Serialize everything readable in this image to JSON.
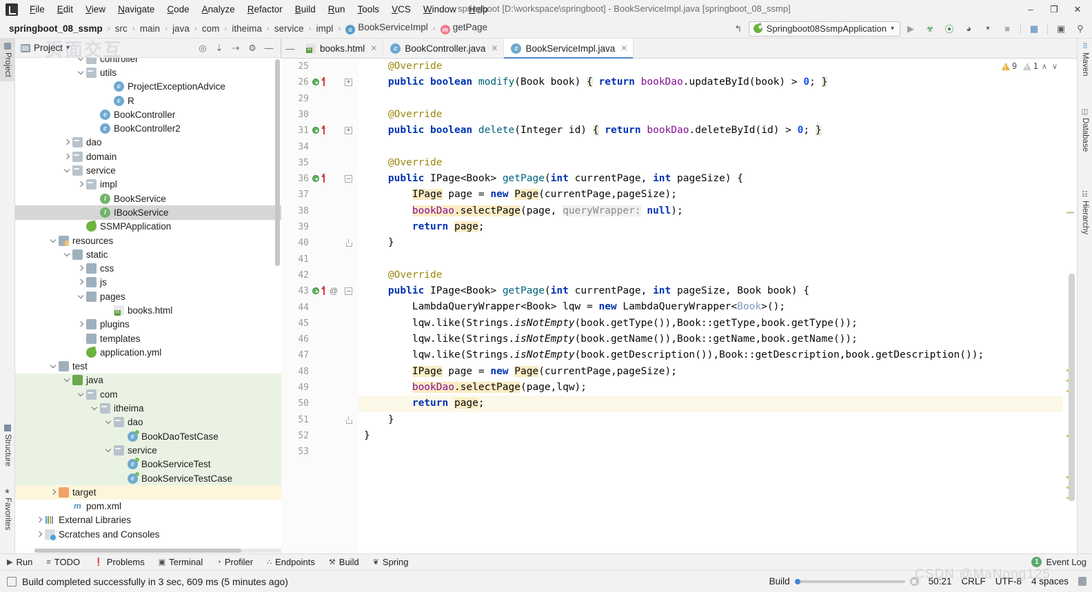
{
  "window": {
    "title": "springboot [D:\\workspace\\springboot] - BookServiceImpl.java [springboot_08_ssmp]",
    "minimize": "–",
    "maximize": "❐",
    "close": "✕"
  },
  "menubar": {
    "items": [
      "File",
      "Edit",
      "View",
      "Navigate",
      "Code",
      "Analyze",
      "Refactor",
      "Build",
      "Run",
      "Tools",
      "VCS",
      "Window",
      "Help"
    ]
  },
  "navbar": {
    "crumbs": [
      {
        "label": "springboot_08_ssmp",
        "bold": true,
        "icon": ""
      },
      {
        "label": "src",
        "bold": false,
        "icon": ""
      },
      {
        "label": "main",
        "bold": false,
        "icon": ""
      },
      {
        "label": "java",
        "bold": false,
        "icon": ""
      },
      {
        "label": "com",
        "bold": false,
        "icon": ""
      },
      {
        "label": "itheima",
        "bold": false,
        "icon": ""
      },
      {
        "label": "service",
        "bold": false,
        "icon": ""
      },
      {
        "label": "impl",
        "bold": false,
        "icon": ""
      },
      {
        "label": "BookServiceImpl",
        "bold": false,
        "icon": "c"
      },
      {
        "label": "getPage",
        "bold": false,
        "icon": "m"
      }
    ],
    "separator": "›",
    "run_config": "Springboot08SsmpApplication",
    "run_config_caret": "▾",
    "back_arrow_icon": "back-arrow-icon",
    "buttons": [
      {
        "name": "run-button",
        "glyph": "▶"
      },
      {
        "name": "debug-button",
        "glyph": "☢"
      },
      {
        "name": "run-with-coverage-button",
        "glyph": "⧉"
      },
      {
        "name": "profile-button",
        "glyph": "◔"
      },
      {
        "name": "profile-dropdown",
        "glyph": "▾"
      },
      {
        "name": "stop-button",
        "glyph": "■"
      },
      {
        "name": "project-structure-button",
        "glyph": "▤"
      },
      {
        "name": "search-everywhere-button",
        "glyph": "⌕"
      }
    ]
  },
  "left_strip": {
    "project_label": "Project",
    "structure_label": "Structure",
    "favorites_label": "Favorites"
  },
  "right_strip": {
    "maven_label": "Maven",
    "database_label": "Database",
    "hierarchy_label": "Hierarchy"
  },
  "project_panel": {
    "title": "Project",
    "title_caret": "▾",
    "watermark": "页面交互",
    "tools": [
      {
        "name": "locate-file-icon",
        "glyph": "⌖"
      },
      {
        "name": "expand-all-icon",
        "glyph": "⤓"
      },
      {
        "name": "collapse-all-icon",
        "glyph": "⤒"
      },
      {
        "name": "settings-gear-icon",
        "glyph": "⚙"
      },
      {
        "name": "hide-panel-icon",
        "glyph": "—"
      }
    ],
    "tree": [
      {
        "label": "controller",
        "indent": 4,
        "arrow": "d",
        "icon": "f-pkg",
        "state": "clipped"
      },
      {
        "label": "utils",
        "indent": 4,
        "arrow": "d",
        "icon": "f-pkg",
        "state": ""
      },
      {
        "label": "ProjectExceptionAdvice",
        "indent": 6,
        "arrow": "",
        "icon": "cls",
        "state": ""
      },
      {
        "label": "R",
        "indent": 6,
        "arrow": "",
        "icon": "cls",
        "state": ""
      },
      {
        "label": "BookController",
        "indent": 5,
        "arrow": "",
        "icon": "cls",
        "state": ""
      },
      {
        "label": "BookController2",
        "indent": 5,
        "arrow": "",
        "icon": "cls",
        "state": ""
      },
      {
        "label": "dao",
        "indent": 3,
        "arrow": "r",
        "icon": "f-pkg",
        "state": ""
      },
      {
        "label": "domain",
        "indent": 3,
        "arrow": "r",
        "icon": "f-pkg",
        "state": ""
      },
      {
        "label": "service",
        "indent": 3,
        "arrow": "d",
        "icon": "f-pkg",
        "state": ""
      },
      {
        "label": "impl",
        "indent": 4,
        "arrow": "r",
        "icon": "f-pkg",
        "state": ""
      },
      {
        "label": "BookService",
        "indent": 5,
        "arrow": "",
        "icon": "iface",
        "state": ""
      },
      {
        "label": "IBookService",
        "indent": 5,
        "arrow": "",
        "icon": "iface",
        "state": "sel"
      },
      {
        "label": "SSMPApplication",
        "indent": 4,
        "arrow": "",
        "icon": "spr",
        "state": ""
      },
      {
        "label": "resources",
        "indent": 2,
        "arrow": "d",
        "icon": "f-res",
        "state": ""
      },
      {
        "label": "static",
        "indent": 3,
        "arrow": "d",
        "icon": "f-plain",
        "state": ""
      },
      {
        "label": "css",
        "indent": 4,
        "arrow": "r",
        "icon": "f-plain",
        "state": ""
      },
      {
        "label": "js",
        "indent": 4,
        "arrow": "r",
        "icon": "f-plain",
        "state": ""
      },
      {
        "label": "pages",
        "indent": 4,
        "arrow": "d",
        "icon": "f-plain",
        "state": ""
      },
      {
        "label": "books.html",
        "indent": 6,
        "arrow": "",
        "icon": "html-ico",
        "state": ""
      },
      {
        "label": "plugins",
        "indent": 4,
        "arrow": "r",
        "icon": "f-plain",
        "state": ""
      },
      {
        "label": "templates",
        "indent": 4,
        "arrow": "",
        "icon": "f-plain",
        "state": ""
      },
      {
        "label": "application.yml",
        "indent": 4,
        "arrow": "",
        "icon": "spr",
        "state": ""
      },
      {
        "label": "test",
        "indent": 2,
        "arrow": "d",
        "icon": "f-plain",
        "state": ""
      },
      {
        "label": "java",
        "indent": 3,
        "arrow": "d",
        "icon": "f-src",
        "state": "green"
      },
      {
        "label": "com",
        "indent": 4,
        "arrow": "d",
        "icon": "f-pkg",
        "state": "green"
      },
      {
        "label": "itheima",
        "indent": 5,
        "arrow": "d",
        "icon": "f-pkg",
        "state": "green"
      },
      {
        "label": "dao",
        "indent": 6,
        "arrow": "d",
        "icon": "f-pkg",
        "state": "green"
      },
      {
        "label": "BookDaoTestCase",
        "indent": 7,
        "arrow": "",
        "icon": "cls test",
        "state": "green"
      },
      {
        "label": "service",
        "indent": 6,
        "arrow": "d",
        "icon": "f-pkg",
        "state": "green"
      },
      {
        "label": "BookServiceTest",
        "indent": 7,
        "arrow": "",
        "icon": "cls test",
        "state": "green"
      },
      {
        "label": "BookServiceTestCase",
        "indent": 7,
        "arrow": "",
        "icon": "cls test",
        "state": "green"
      },
      {
        "label": "target",
        "indent": 2,
        "arrow": "r",
        "icon": "f-tgt",
        "state": "amber"
      },
      {
        "label": "pom.xml",
        "indent": 3,
        "arrow": "",
        "icon": "mvn",
        "state": ""
      },
      {
        "label": "External Libraries",
        "indent": 1,
        "arrow": "r",
        "icon": "lib-ico",
        "state": ""
      },
      {
        "label": "Scratches and Consoles",
        "indent": 1,
        "arrow": "r",
        "icon": "scr-ico",
        "state": ""
      }
    ]
  },
  "editor": {
    "tabs": [
      {
        "label": "books.html",
        "icon": "html-file-icon",
        "active": false
      },
      {
        "label": "BookController.java",
        "icon": "java-class-icon",
        "active": false
      },
      {
        "label": "BookServiceImpl.java",
        "icon": "java-class-icon",
        "active": true
      }
    ],
    "close_glyph": "✕",
    "collapse_glyph": "—",
    "inspections": {
      "warnings": "9",
      "weak_warnings": "1",
      "up_glyph": "∧",
      "down_glyph": "∨"
    },
    "lines": [
      {
        "num": "25",
        "gutter": [],
        "fold": "",
        "html": "    <span class=\"ann\">@Override</span>"
      },
      {
        "num": "26",
        "gutter": [
          "run",
          "impl"
        ],
        "fold": "plus",
        "html": "    <span class=\"kw\">public</span> <span class=\"kw\">boolean</span> <span class=\"fn\">modify</span>(Book book) <span class=\"hl2\">{</span> <span class=\"kw\">return</span> <span class=\"fld\">bookDao</span>.updateById(book) &gt; <span class=\"num\">0</span>; <span class=\"hl2\">}</span>"
      },
      {
        "num": "29",
        "gutter": [],
        "fold": "",
        "html": ""
      },
      {
        "num": "30",
        "gutter": [],
        "fold": "",
        "html": "    <span class=\"ann\">@Override</span>"
      },
      {
        "num": "31",
        "gutter": [
          "run",
          "impl"
        ],
        "fold": "plus",
        "html": "    <span class=\"kw\">public</span> <span class=\"kw\">boolean</span> <span class=\"fn\">delete</span>(Integer id) <span class=\"hl2\">{</span> <span class=\"kw\">return</span> <span class=\"fld\">bookDao</span>.deleteById(id) &gt; <span class=\"num\">0</span>; <span class=\"hl2\">}</span>"
      },
      {
        "num": "34",
        "gutter": [],
        "fold": "",
        "html": ""
      },
      {
        "num": "35",
        "gutter": [],
        "fold": "",
        "html": "    <span class=\"ann\">@Override</span>"
      },
      {
        "num": "36",
        "gutter": [
          "run",
          "impl"
        ],
        "fold": "minus",
        "html": "    <span class=\"kw\">public</span> IPage&lt;Book&gt; <span class=\"fn\">getPage</span>(<span class=\"kw\">int</span> currentPage, <span class=\"kw\">int</span> pageSize) {"
      },
      {
        "num": "37",
        "gutter": [],
        "fold": "",
        "html": "        <span class=\"hl\">IPage</span> page = <span class=\"kw\">new</span> <span class=\"hl\">Page</span>(currentPage,pageSize);"
      },
      {
        "num": "38",
        "gutter": [],
        "fold": "",
        "html": "        <span class=\"hl\"><span class=\"fld\">bookDao</span>.selectPage</span>(page, <span class=\"hint\">queryWrapper:</span> <span class=\"kw\">null</span>);"
      },
      {
        "num": "39",
        "gutter": [],
        "fold": "",
        "html": "        <span class=\"kw\">return</span> <span class=\"hl\">page</span>;"
      },
      {
        "num": "40",
        "gutter": [],
        "fold": "end",
        "html": "    }"
      },
      {
        "num": "41",
        "gutter": [],
        "fold": "",
        "html": ""
      },
      {
        "num": "42",
        "gutter": [],
        "fold": "",
        "html": "    <span class=\"ann\">@Override</span>"
      },
      {
        "num": "43",
        "gutter": [
          "run",
          "impl",
          "at"
        ],
        "fold": "minus",
        "html": "    <span class=\"kw\">public</span> IPage&lt;Book&gt; <span class=\"fn\">getPage</span>(<span class=\"kw\">int</span> currentPage, <span class=\"kw\">int</span> pageSize, Book book) {"
      },
      {
        "num": "44",
        "gutter": [],
        "fold": "",
        "html": "        LambdaQueryWrapper&lt;Book&gt; lqw = <span class=\"kw\">new</span> LambdaQueryWrapper&lt;<span class=\"gen\">Book</span>&gt;();"
      },
      {
        "num": "45",
        "gutter": [],
        "fold": "",
        "html": "        lqw.like(Strings.<span class=\"ital\">isNotEmpty</span>(book.getType()),Book::getType,book.getType());"
      },
      {
        "num": "46",
        "gutter": [],
        "fold": "",
        "html": "        lqw.like(Strings.<span class=\"ital\">isNotEmpty</span>(book.getName()),Book::getName,book.getName());"
      },
      {
        "num": "47",
        "gutter": [],
        "fold": "",
        "html": "        lqw.like(Strings.<span class=\"ital\">isNotEmpty</span>(book.getDescription()),Book::getDescription,book.getDescription());"
      },
      {
        "num": "48",
        "gutter": [],
        "fold": "",
        "html": "        <span class=\"hl\">IPage</span> page = <span class=\"kw\">new</span> <span class=\"hl\">Page</span>(currentPage,pageSize);"
      },
      {
        "num": "49",
        "gutter": [],
        "fold": "",
        "html": "        <span class=\"hl\"><span class=\"fld\">bookDao</span>.selectPage</span>(page,lqw);"
      },
      {
        "num": "50",
        "gutter": [],
        "fold": "",
        "current": true,
        "html": "        <span class=\"kw\">return</span> <span class=\"hl\">page</span>;"
      },
      {
        "num": "51",
        "gutter": [],
        "fold": "end",
        "html": "    }"
      },
      {
        "num": "52",
        "gutter": [],
        "fold": "",
        "html": "}"
      },
      {
        "num": "53",
        "gutter": [],
        "fold": "",
        "html": ""
      }
    ]
  },
  "toolwindow_bar": {
    "items": [
      {
        "label": "Run",
        "icon": "run-icon",
        "glyph": "▶"
      },
      {
        "label": "TODO",
        "icon": "todo-icon",
        "glyph": "≡"
      },
      {
        "label": "Problems",
        "icon": "problems-icon",
        "glyph": "❗"
      },
      {
        "label": "Terminal",
        "icon": "terminal-icon",
        "glyph": "▣"
      },
      {
        "label": "Profiler",
        "icon": "profiler-icon",
        "glyph": "◔"
      },
      {
        "label": "Endpoints",
        "icon": "endpoints-icon",
        "glyph": "∴"
      },
      {
        "label": "Build",
        "icon": "build-icon",
        "glyph": "⚒"
      },
      {
        "label": "Spring",
        "icon": "spring-icon",
        "glyph": "❦"
      }
    ],
    "event_log": "Event Log",
    "event_badge": "1"
  },
  "statusbar": {
    "message": "Build completed successfully in 3 sec, 609 ms (5 minutes ago)",
    "build_label": "Build",
    "caret_position": "50:21",
    "line_separator": "CRLF",
    "encoding": "UTF-8",
    "indent": "4 spaces",
    "watermark": "CSDN @MaNong125"
  }
}
